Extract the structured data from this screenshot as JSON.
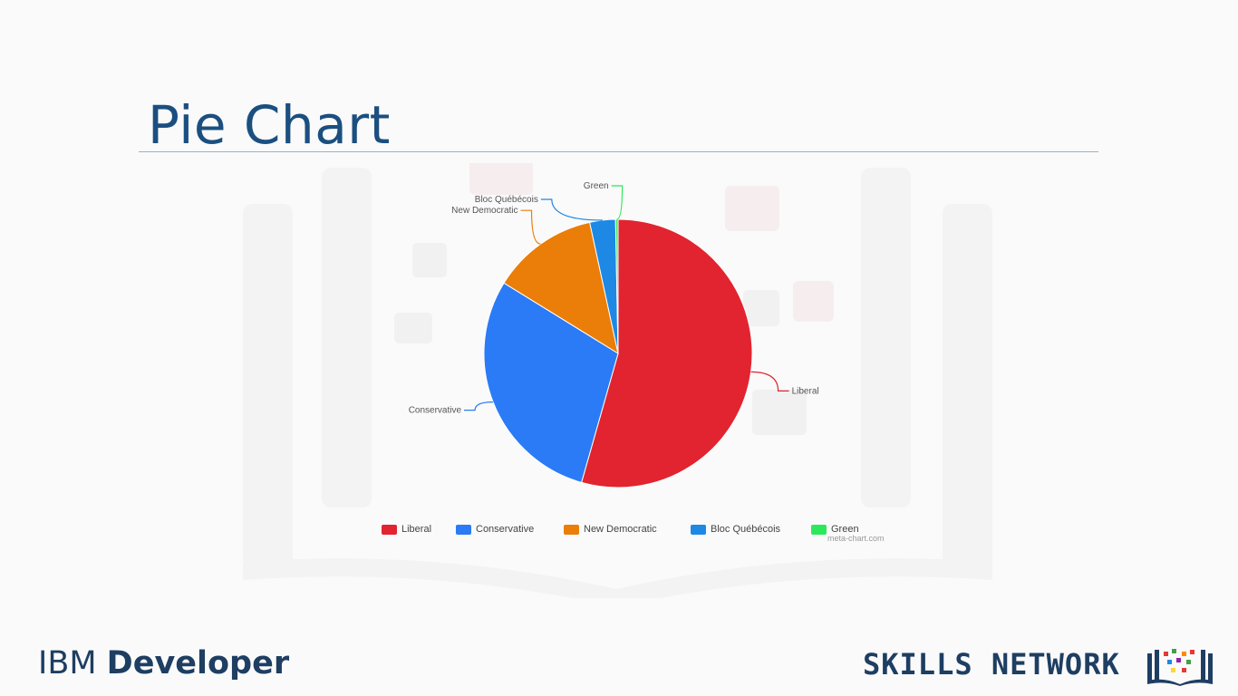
{
  "slide": {
    "title": "Pie Chart"
  },
  "chart_data": {
    "type": "pie",
    "title": "",
    "categories": [
      "Liberal",
      "Conservative",
      "New Democratic",
      "Bloc Québécois",
      "Green"
    ],
    "values": [
      54.4,
      29.4,
      12.8,
      3.1,
      0.3
    ],
    "colors": [
      "#e12430",
      "#2a7bf5",
      "#ea7e08",
      "#1e88e5",
      "#2ee85c"
    ],
    "labels": [
      "Liberal",
      "Conservative",
      "New Democratic",
      "Bloc Québécois",
      "Green"
    ],
    "legend_position": "bottom",
    "credit": "meta-chart.com"
  },
  "footer": {
    "brand_left_light": "IBM ",
    "brand_left_bold": "Developer",
    "brand_right": "SKILLS NETWORK"
  }
}
